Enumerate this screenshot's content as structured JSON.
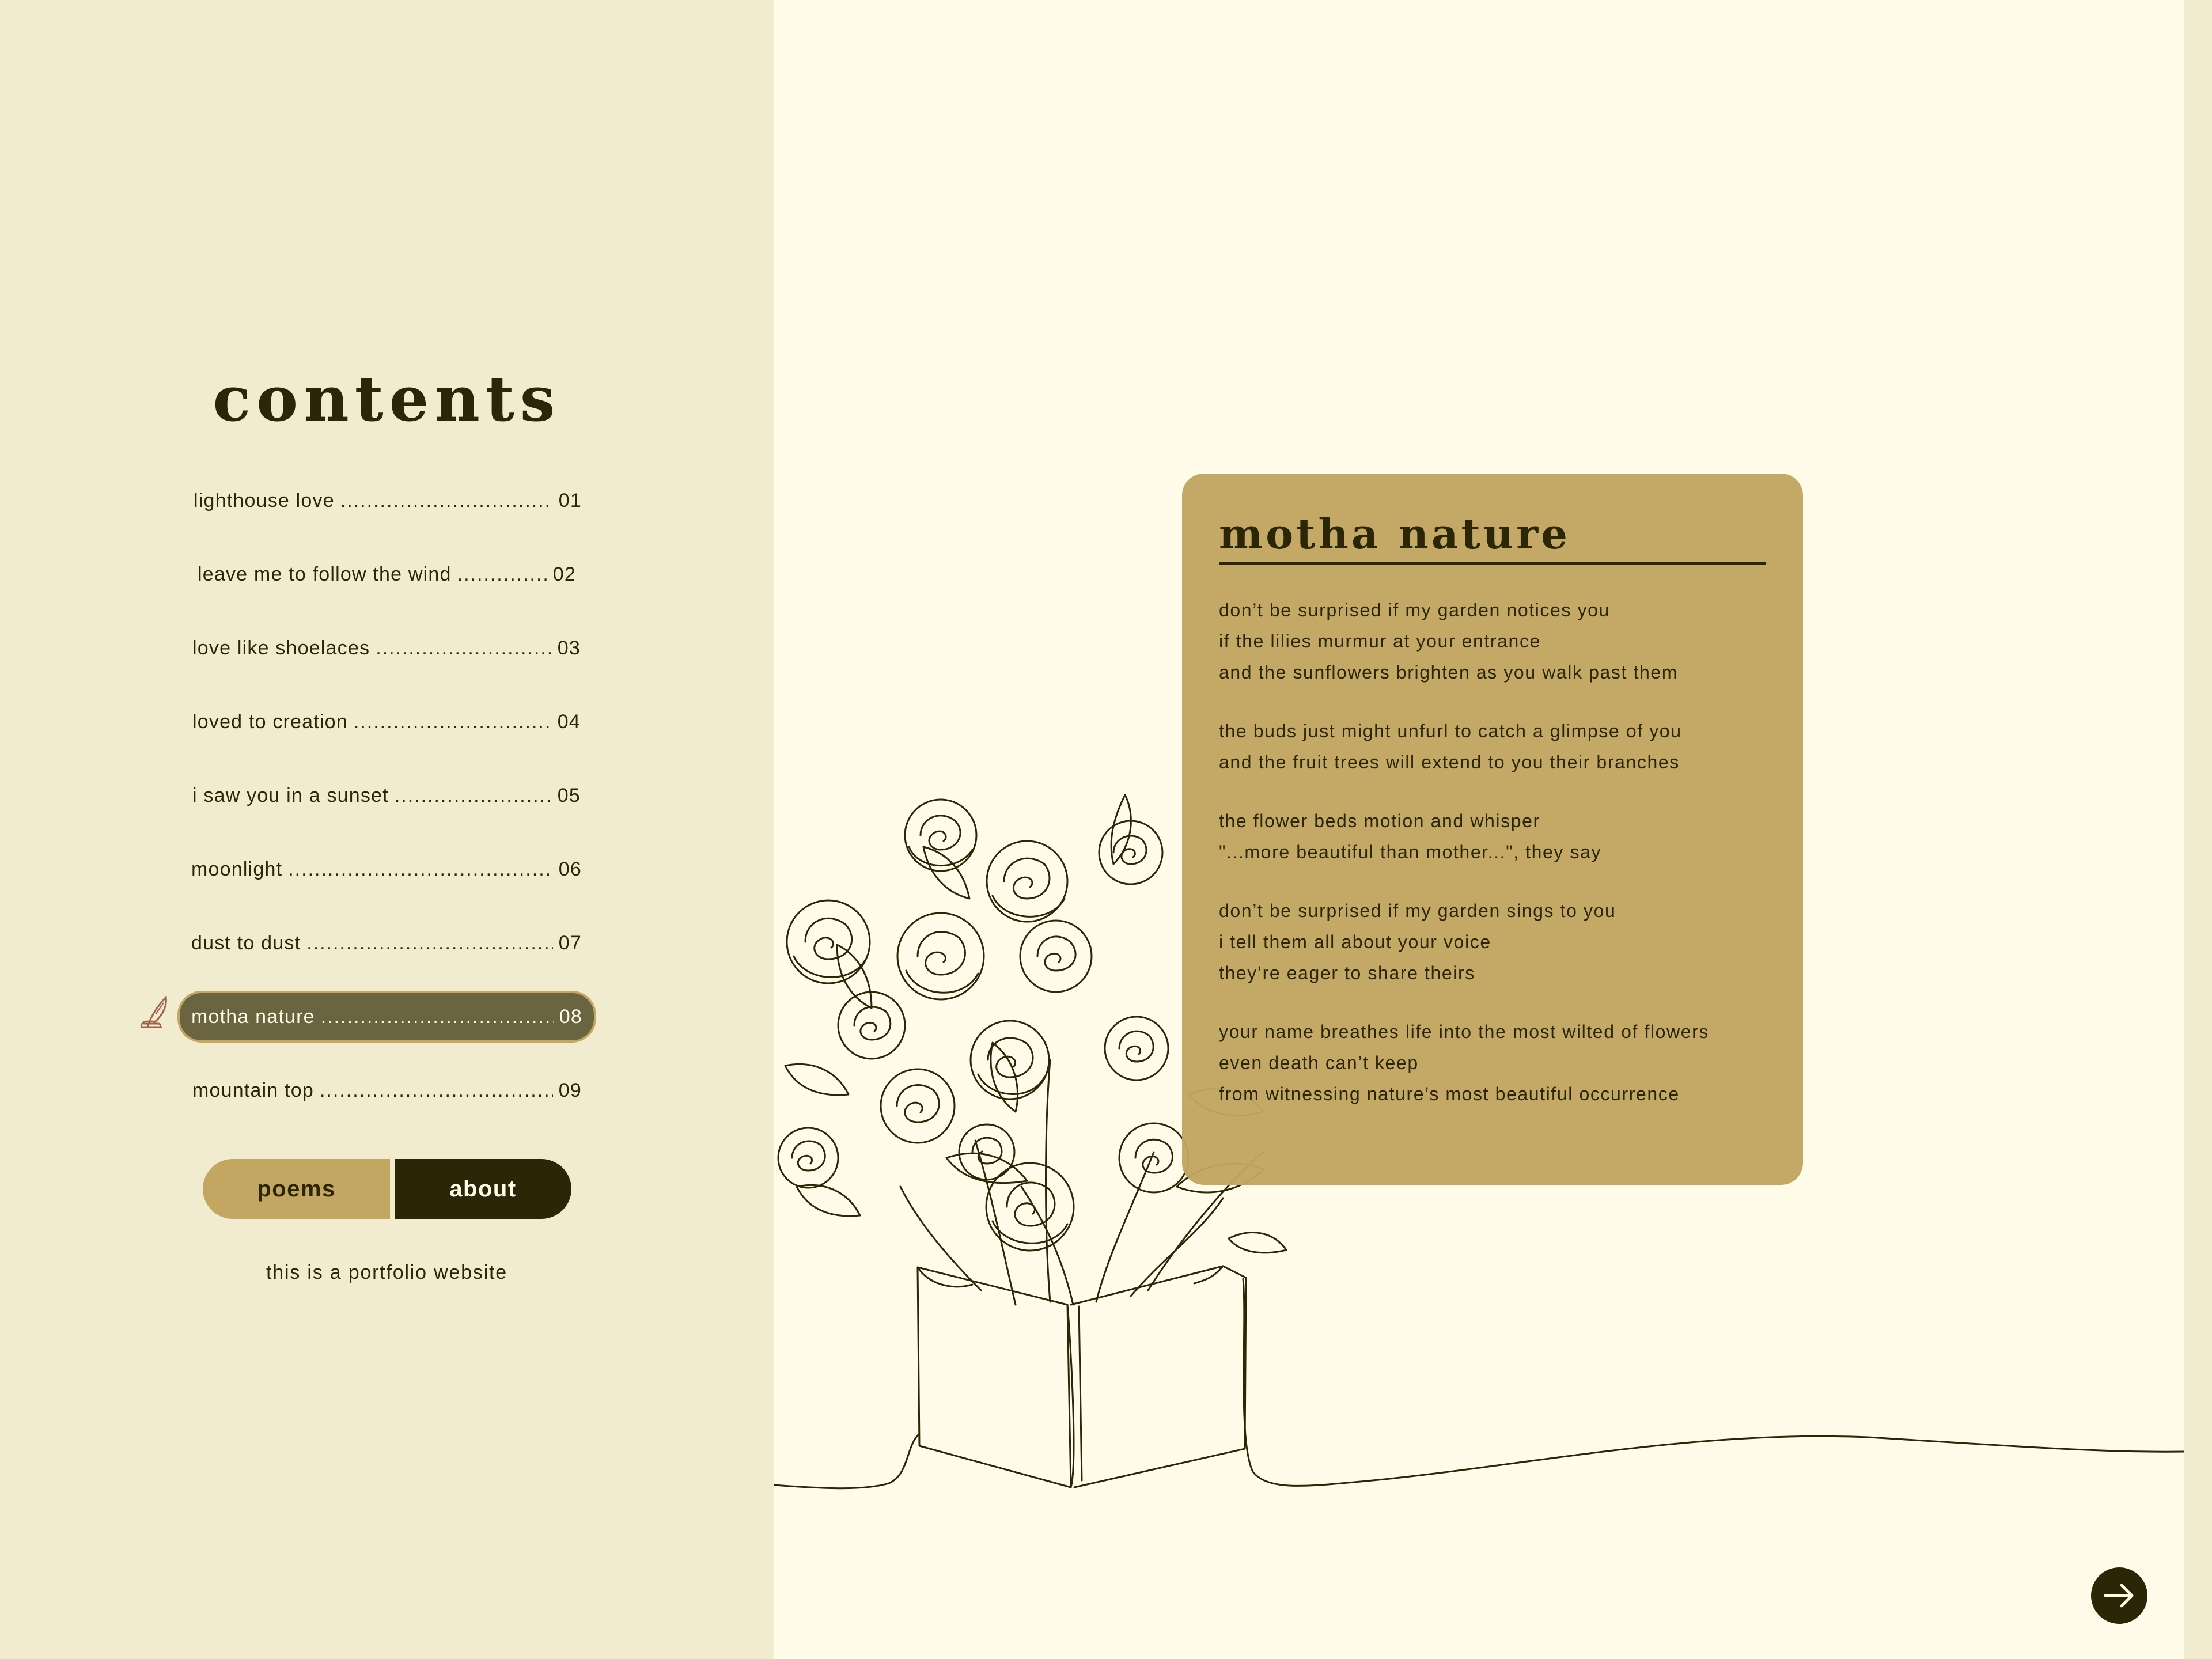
{
  "sidebar": {
    "title": "contents",
    "toc": [
      {
        "title": "lighthouse love",
        "num": "01"
      },
      {
        "title": "leave me to follow the wind",
        "num": "02"
      },
      {
        "title": "love like shoelaces",
        "num": "03"
      },
      {
        "title": "loved to creation",
        "num": "04"
      },
      {
        "title": "i saw you in a sunset",
        "num": "05"
      },
      {
        "title": "moonlight",
        "num": "06"
      },
      {
        "title": "dust to dust",
        "num": "07"
      },
      {
        "title": "motha nature",
        "num": "08",
        "active": true
      },
      {
        "title": "mountain top",
        "num": "09"
      }
    ],
    "active_icon": "quill-pen-icon",
    "buttons": {
      "poems": "poems",
      "about": "about"
    },
    "tagline": "this is a portfolio website"
  },
  "poem": {
    "title": "motha nature",
    "stanzas": [
      [
        "don’t be surprised if my garden notices you",
        "if the lilies murmur at your entrance",
        "and the sunflowers brighten as you walk past them"
      ],
      [
        "the buds just might unfurl to catch a glimpse of you",
        "and the fruit trees will extend to you their branches"
      ],
      [
        "the flower beds motion and whisper",
        "\"...more beautiful than mother...\", they say"
      ],
      [
        "don’t be surprised if my garden sings to you",
        "i tell them all about your voice",
        "they’re eager to share theirs"
      ],
      [
        "your name breathes life into the most wilted of flowers",
        "even death can’t keep",
        "from witnessing nature’s most beautiful occurrence"
      ]
    ]
  },
  "illustration": "roses-in-book-line-drawing",
  "next_icon": "arrow-right-icon",
  "colors": {
    "background": "#fefce8",
    "sidebar": "#f1ecd0",
    "accent_gold": "#c2a661",
    "dark": "#2a2606",
    "active_row": "#6b6440"
  }
}
